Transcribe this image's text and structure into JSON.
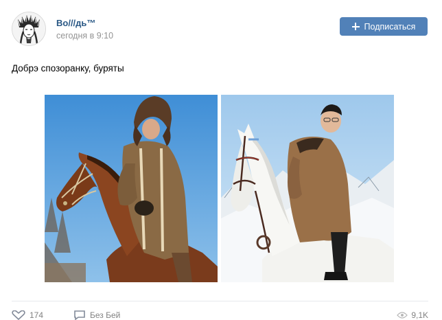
{
  "post": {
    "author_name": "Во///дь™",
    "time": "сегодня в 9:10",
    "subscribe_label": "Подписаться",
    "text": "Добрэ спозоранку, буряты",
    "photos": [
      {
        "alt": "Всадник в меховой шапке на гнедой лошади"
      },
      {
        "alt": "Всадник в пальто на белой лошади"
      }
    ],
    "footer": {
      "likes": "174",
      "comment_label": "Без Бей",
      "views": "9,1K"
    }
  },
  "colors": {
    "accent": "#5181b8",
    "link": "#2a5885",
    "muted": "#939393",
    "background": "#ffffff"
  },
  "icons": [
    "avatar-portrait",
    "plus-icon",
    "heart-icon",
    "comment-icon",
    "eye-icon"
  ]
}
